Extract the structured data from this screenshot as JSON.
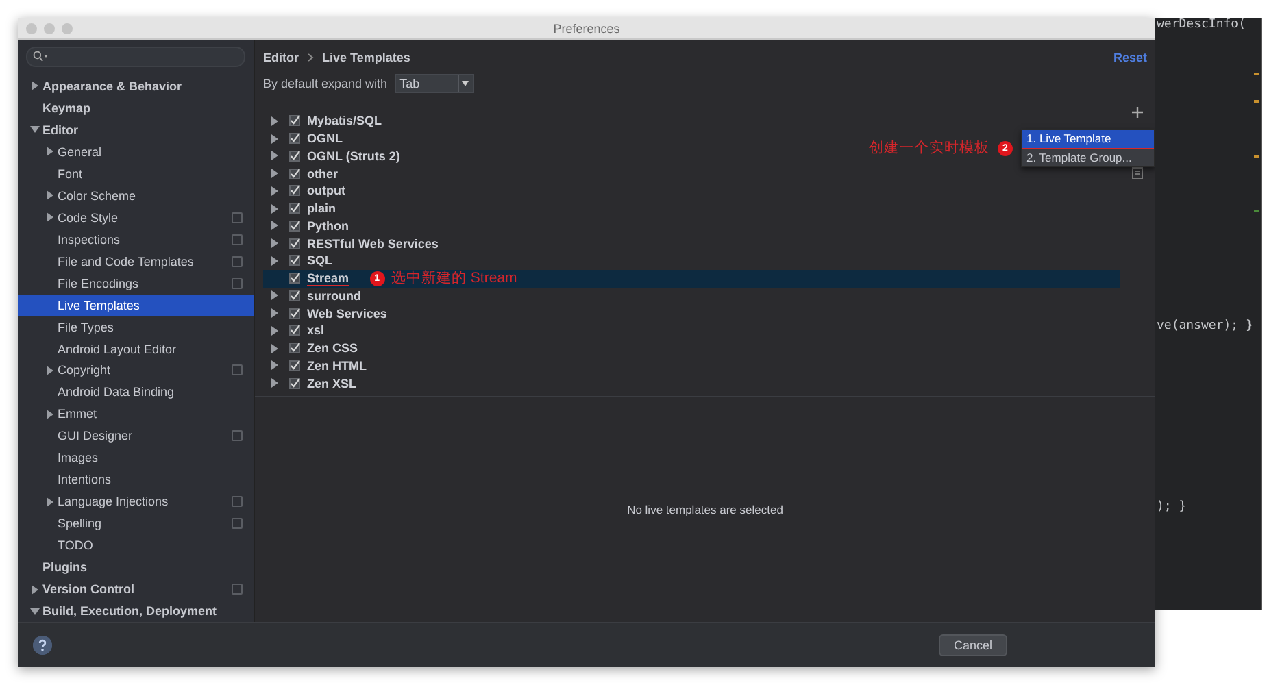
{
  "window": {
    "title": "Preferences"
  },
  "sidebar": {
    "items": [
      {
        "label": "Appearance & Behavior",
        "expanded": false,
        "selected": false
      },
      {
        "label": "Keymap",
        "selected": false
      },
      {
        "label": "Editor",
        "expanded": true,
        "selected": false,
        "children": [
          {
            "label": "General",
            "expanded": false,
            "selected": false
          },
          {
            "label": "Font",
            "selected": false
          },
          {
            "label": "Color Scheme",
            "expanded": false,
            "selected": false
          },
          {
            "label": "Code Style",
            "expanded": false,
            "project": true,
            "selected": false
          },
          {
            "label": "Inspections",
            "project": true,
            "selected": false
          },
          {
            "label": "File and Code Templates",
            "project": true,
            "selected": false
          },
          {
            "label": "File Encodings",
            "project": true,
            "selected": false
          },
          {
            "label": "Live Templates",
            "selected": true
          },
          {
            "label": "File Types",
            "selected": false
          },
          {
            "label": "Android Layout Editor",
            "selected": false
          },
          {
            "label": "Copyright",
            "expanded": false,
            "project": true,
            "selected": false
          },
          {
            "label": "Android Data Binding",
            "selected": false
          },
          {
            "label": "Emmet",
            "expanded": false,
            "selected": false
          },
          {
            "label": "GUI Designer",
            "project": true,
            "selected": false
          },
          {
            "label": "Images",
            "selected": false
          },
          {
            "label": "Intentions",
            "selected": false
          },
          {
            "label": "Language Injections",
            "expanded": false,
            "project": true,
            "selected": false
          },
          {
            "label": "Spelling",
            "project": true,
            "selected": false
          },
          {
            "label": "TODO",
            "selected": false
          }
        ]
      },
      {
        "label": "Plugins",
        "selected": false
      },
      {
        "label": "Version Control",
        "expanded": false,
        "project": true,
        "selected": false
      },
      {
        "label": "Build, Execution, Deployment",
        "expanded": true,
        "selected": false
      }
    ]
  },
  "breadcrumb": [
    "Editor",
    "Live Templates"
  ],
  "reset": "Reset",
  "expand_with": {
    "label": "By default expand with",
    "value": "Tab"
  },
  "template_groups": [
    {
      "name": "Mybatis/SQL",
      "checked": true,
      "expandable": true,
      "selected": false
    },
    {
      "name": "OGNL",
      "checked": true,
      "expandable": true,
      "selected": false
    },
    {
      "name": "OGNL (Struts 2)",
      "checked": true,
      "expandable": true,
      "selected": false
    },
    {
      "name": "other",
      "checked": true,
      "expandable": true,
      "selected": false
    },
    {
      "name": "output",
      "checked": true,
      "expandable": true,
      "selected": false
    },
    {
      "name": "plain",
      "checked": true,
      "expandable": true,
      "selected": false
    },
    {
      "name": "Python",
      "checked": true,
      "expandable": true,
      "selected": false
    },
    {
      "name": "RESTful Web Services",
      "checked": true,
      "expandable": true,
      "selected": false
    },
    {
      "name": "SQL",
      "checked": true,
      "expandable": true,
      "selected": false
    },
    {
      "name": "Stream",
      "checked": true,
      "expandable": false,
      "selected": true,
      "note": {
        "number": "1",
        "text": "选中新建的 Stream"
      }
    },
    {
      "name": "surround",
      "checked": true,
      "expandable": true,
      "selected": false
    },
    {
      "name": "Web Services",
      "checked": true,
      "expandable": true,
      "selected": false
    },
    {
      "name": "xsl",
      "checked": true,
      "expandable": true,
      "selected": false
    },
    {
      "name": "Zen CSS",
      "checked": true,
      "expandable": true,
      "selected": false
    },
    {
      "name": "Zen HTML",
      "checked": true,
      "expandable": true,
      "selected": false
    },
    {
      "name": "Zen XSL",
      "checked": true,
      "expandable": true,
      "selected": false
    }
  ],
  "add_menu": {
    "note": {
      "number": "2",
      "text": "创建一个实时模板"
    },
    "items": [
      {
        "label": "1. Live Template",
        "selected": true
      },
      {
        "label": "2. Template Group...",
        "selected": false
      }
    ]
  },
  "detail": {
    "message": "No live templates are selected"
  },
  "buttons": [
    {
      "label": "Cancel"
    }
  ],
  "background_code": [
    "werDescInfo(",
    "ve(answer); }",
    "); }"
  ]
}
